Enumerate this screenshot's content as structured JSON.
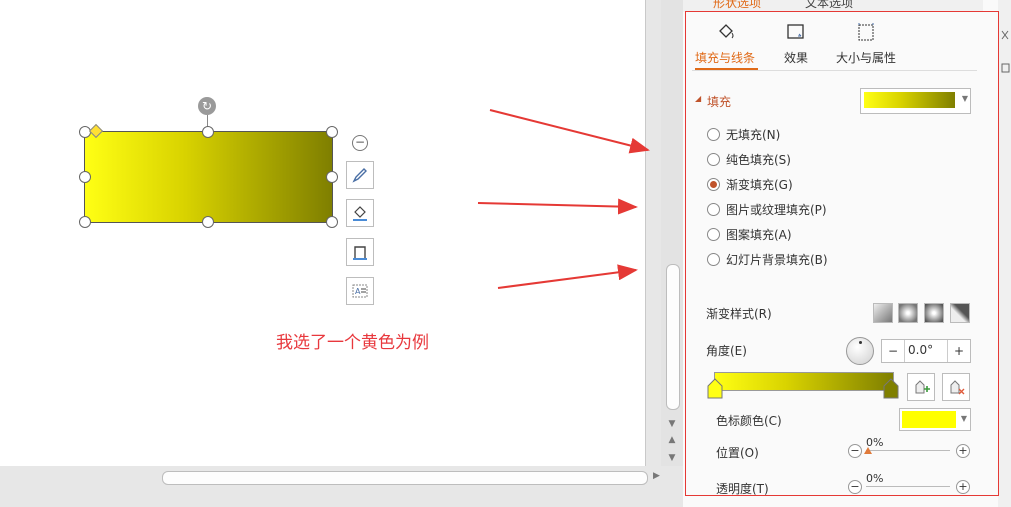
{
  "panel": {
    "top_tabs": [
      "形状选项",
      "文本选项"
    ],
    "sub_tabs": [
      {
        "label": "填充与线条",
        "icon": "fill-bucket-icon",
        "active": true
      },
      {
        "label": "效果",
        "icon": "effects-icon",
        "active": false
      },
      {
        "label": "大小与属性",
        "icon": "size-properties-icon",
        "active": false
      }
    ],
    "fill_section": "填充",
    "fill_options": [
      {
        "label": "无填充(N)",
        "selected": false
      },
      {
        "label": "纯色填充(S)",
        "selected": false
      },
      {
        "label": "渐变填充(G)",
        "selected": true
      },
      {
        "label": "图片或纹理填充(P)",
        "selected": false
      },
      {
        "label": "图案填充(A)",
        "selected": false
      },
      {
        "label": "幻灯片背景填充(B)",
        "selected": false
      }
    ],
    "gradient_style_label": "渐变样式(R)",
    "angle_label": "角度(E)",
    "angle_value": "0.0°",
    "minus": "−",
    "plus": "+",
    "stop_color_label": "色标颜色(C)",
    "position_label": "位置(O)",
    "position_value": "0%",
    "transparency_label": "透明度(T)",
    "transparency_value": "0%",
    "colors": {
      "accent": "#e06a18",
      "gradient_start": "#ffff14",
      "gradient_end": "#7f7f00",
      "stop_color": "#ffff00"
    }
  },
  "canvas": {
    "note": "我选了一个黄色为例"
  }
}
